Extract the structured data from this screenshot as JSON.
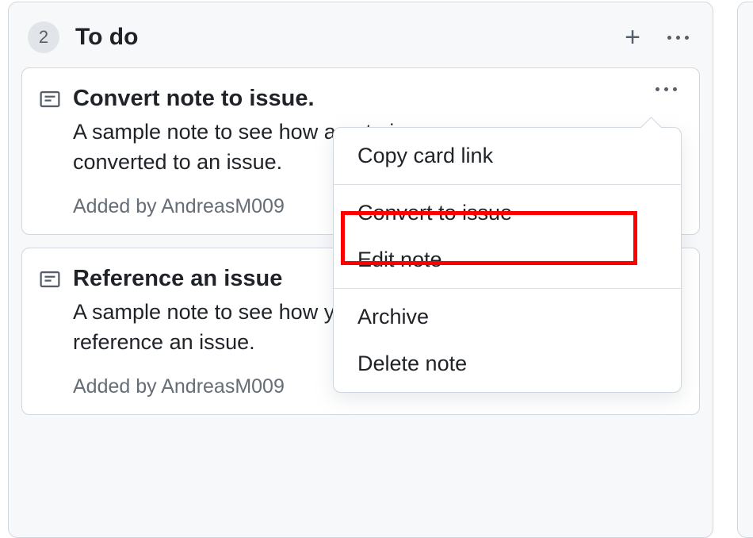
{
  "column": {
    "count": "2",
    "title": "To do"
  },
  "cards": [
    {
      "title": "Convert note to issue.",
      "description": "A sample note to see how a note is\nconverted to an issue.",
      "meta": "Added by AndreasM009"
    },
    {
      "title": "Reference an issue",
      "description": "A sample note to see how you can\nreference an issue.",
      "meta": "Added by AndreasM009"
    }
  ],
  "menu": {
    "copy_link": "Copy card link",
    "convert": "Convert to issue",
    "edit": "Edit note",
    "archive": "Archive",
    "delete": "Delete note"
  }
}
